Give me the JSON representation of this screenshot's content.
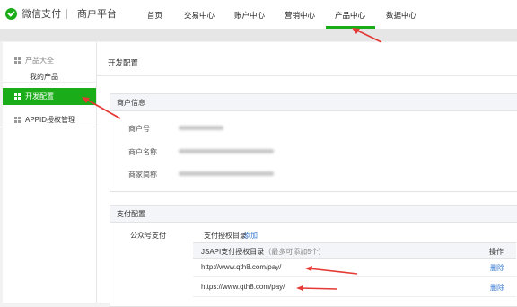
{
  "brand": {
    "logo_label": "微信支付",
    "platform": "商户平台",
    "brand_color": "#1aad19"
  },
  "topnav": {
    "items": [
      {
        "label": "首页"
      },
      {
        "label": "交易中心"
      },
      {
        "label": "账户中心"
      },
      {
        "label": "营销中心"
      },
      {
        "label": "产品中心"
      },
      {
        "label": "数据中心"
      }
    ],
    "active": "产品中心"
  },
  "sidebar": {
    "group_label": "产品大全",
    "group_link": "我的产品",
    "active_item": "开发配置",
    "item": "APPID授权管理"
  },
  "main": {
    "title": "开发配置",
    "merchant": {
      "heading": "商户信息",
      "fields": [
        {
          "label": "商户号"
        },
        {
          "label": "商户名称"
        },
        {
          "label": "商家简称"
        }
      ]
    },
    "payment": {
      "heading": "支付配置",
      "row_label": "公众号支付",
      "dir_label": "支付授权目录",
      "add_label": "添加",
      "table_header": "JSAPI支付授权目录",
      "table_hint": "（最多可添加5个）",
      "op_header": "操作",
      "rows": [
        {
          "url": "http://www.qth8.com/pay/",
          "action": "删除"
        },
        {
          "url": "https://www.qth8.com/pay/",
          "action": "删除"
        }
      ]
    }
  },
  "annotation": {
    "arrow_color": "#e53935"
  }
}
